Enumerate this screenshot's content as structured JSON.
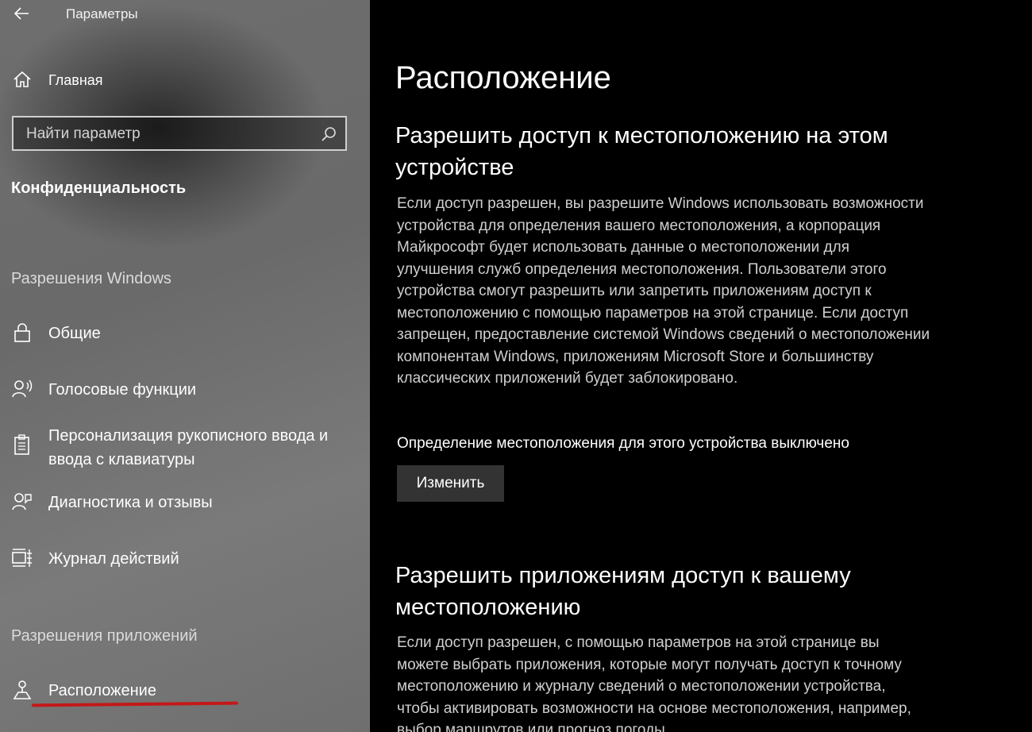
{
  "window": {
    "title": "Параметры"
  },
  "sidebar": {
    "home_label": "Главная",
    "search_placeholder": "Найти параметр",
    "section_title": "Конфиденциальность",
    "group_windows": "Разрешения Windows",
    "items_windows": [
      {
        "label": "Общие",
        "icon": "lock-icon"
      },
      {
        "label": "Голосовые функции",
        "icon": "speech-icon"
      },
      {
        "label": "Персонализация рукописного ввода и\nввода с клавиатуры",
        "icon": "clipboard-icon"
      },
      {
        "label": "Диагностика и отзывы",
        "icon": "feedback-icon"
      },
      {
        "label": "Журнал действий",
        "icon": "timeline-icon"
      }
    ],
    "group_apps": "Разрешения приложений",
    "items_apps": [
      {
        "label": "Расположение",
        "icon": "location-icon"
      }
    ],
    "highlight_color": "#c41818"
  },
  "main": {
    "page_title": "Расположение",
    "section1_heading": "Разрешить доступ к местоположению на этом устройстве",
    "section1_text": "Если доступ разрешен, вы разрешите Windows использовать возможности устройства для определения вашего местоположения, а корпорация Майкрософт будет использовать данные о местоположении для улучшения служб определения местоположения. Пользователи этого устройства смогут разрешить или запретить приложениям доступ к местоположению с помощью параметров на этой странице. Если доступ запрещен, предоставление системой Windows сведений о местоположении компонентам Windows, приложениям Microsoft Store и большинству классических приложений будет заблокировано.",
    "status_text": "Определение местоположения для этого устройства выключено",
    "change_button": "Изменить",
    "section2_heading": "Разрешить приложениям доступ к вашему местоположению",
    "section2_text": "Если доступ разрешен, с помощью параметров на этой странице вы можете выбрать приложения, которые могут получать доступ к точному местоположению и журналу сведений о местоположении устройства, чтобы активировать возможности на основе местоположения, например, выбор маршрутов или прогноз погоды"
  }
}
